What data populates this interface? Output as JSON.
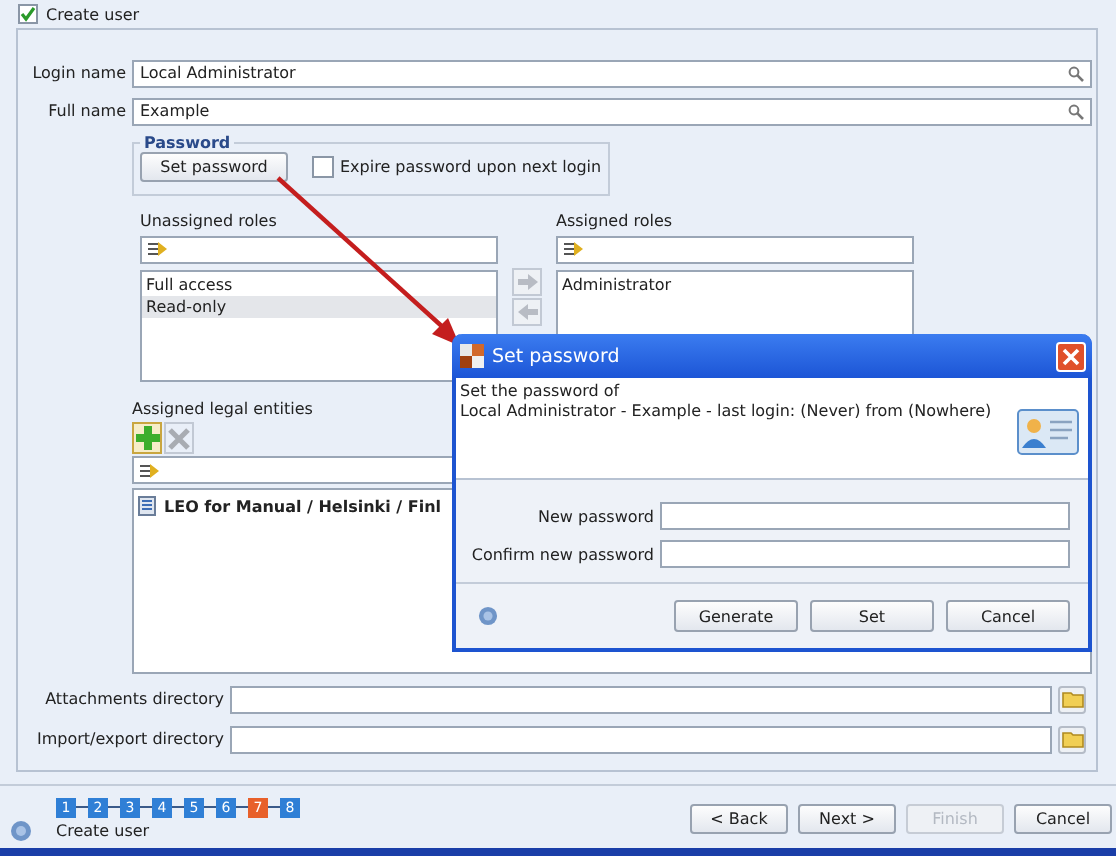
{
  "create_user": {
    "label": "Create user",
    "checked": true
  },
  "fields": [
    {
      "label": "Login name",
      "value": "Local Administrator"
    },
    {
      "label": "Full name",
      "value": "Example"
    }
  ],
  "password": {
    "title": "Password",
    "button": "Set password",
    "expire": {
      "label": "Expire password upon next login",
      "checked": false
    }
  },
  "unassigned_roles": {
    "label": "Unassigned roles",
    "items": [
      {
        "text": "Full access",
        "selected": false
      },
      {
        "text": "Read-only",
        "selected": true
      }
    ]
  },
  "assigned_roles": {
    "label": "Assigned roles",
    "items": [
      {
        "text": "Administrator",
        "selected": false
      }
    ]
  },
  "legal_entities": {
    "label": "Assigned legal entities",
    "items": [
      {
        "text": "LEO for Manual / Helsinki / Finl"
      }
    ]
  },
  "directories": [
    {
      "label": "Attachments directory"
    },
    {
      "label": "Import/export directory"
    }
  ],
  "wizard": {
    "steps": [
      {
        "number": "1",
        "selected": false
      },
      {
        "number": "2",
        "selected": false
      },
      {
        "number": "3",
        "selected": false
      },
      {
        "number": "4",
        "selected": false
      },
      {
        "number": "5",
        "selected": false
      },
      {
        "number": "6",
        "selected": false
      },
      {
        "number": "7",
        "selected": true
      },
      {
        "number": "8",
        "selected": false
      }
    ],
    "caption": "Create user"
  },
  "buttons": [
    {
      "label": "< Back",
      "disabled": false
    },
    {
      "label": "Next >",
      "disabled": false
    },
    {
      "label": "Finish",
      "disabled": true
    },
    {
      "label": "Cancel",
      "disabled": false
    }
  ],
  "dialog": {
    "title": "Set password",
    "description": [
      "Set the password of",
      "Local Administrator - Example - last login: (Never) from (Nowhere)"
    ],
    "fields": [
      {
        "label": "New password"
      },
      {
        "label": "Confirm new password"
      }
    ],
    "buttons": [
      {
        "label": "Generate"
      },
      {
        "label": "Set"
      },
      {
        "label": "Cancel"
      }
    ]
  }
}
